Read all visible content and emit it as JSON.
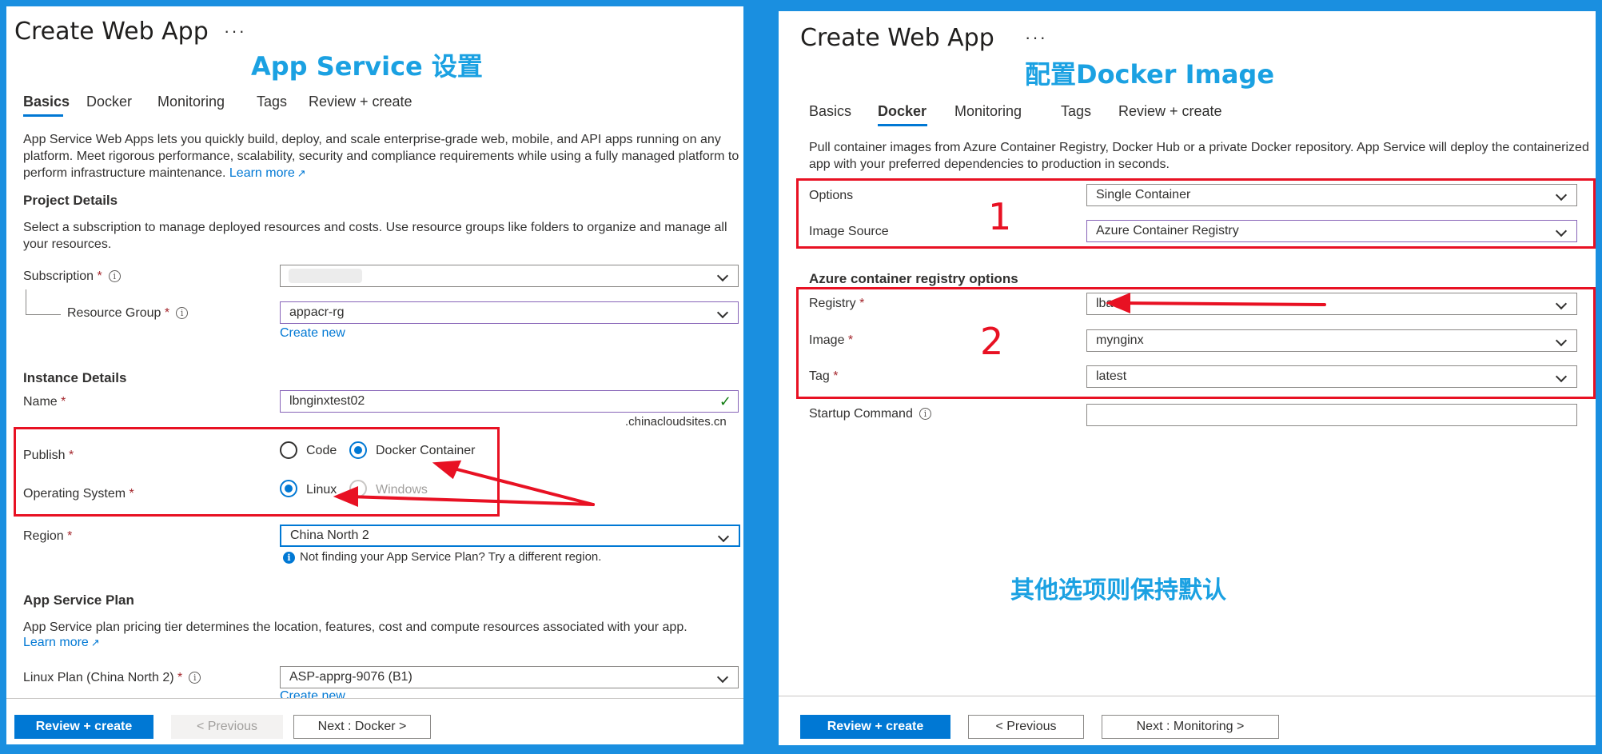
{
  "left": {
    "title": "Create Web App",
    "more": "···",
    "annotation": "App Service 设置",
    "tabs": [
      "Basics",
      "Docker",
      "Monitoring",
      "Tags",
      "Review + create"
    ],
    "description": "App Service Web Apps lets you quickly build, deploy, and scale enterprise-grade web, mobile, and API apps running on any platform. Meet rigorous performance, scalability, security and compliance requirements while using a fully managed platform to perform infrastructure maintenance.",
    "learn_more": "Learn more",
    "project_details": {
      "heading": "Project Details",
      "description": "Select a subscription to manage deployed resources and costs. Use resource groups like folders to organize and manage all your resources.",
      "subscription_label": "Subscription",
      "subscription_value": "",
      "resource_group_label": "Resource Group",
      "resource_group_value": "appacr-rg",
      "create_new": "Create new"
    },
    "instance_details": {
      "heading": "Instance Details",
      "name_label": "Name",
      "name_value": "lbnginxtest02",
      "domain_suffix": ".chinacloudsites.cn",
      "publish_label": "Publish",
      "publish_options": [
        "Code",
        "Docker Container"
      ],
      "os_label": "Operating System",
      "os_options": [
        "Linux",
        "Windows"
      ],
      "region_label": "Region",
      "region_value": "China North 2",
      "region_hint": "Not finding your App Service Plan? Try a different region."
    },
    "plan": {
      "heading": "App Service Plan",
      "description": "App Service plan pricing tier determines the location, features, cost and compute resources associated with your app.",
      "learn_more": "Learn more",
      "linux_plan_label": "Linux Plan (China North 2)",
      "linux_plan_value": "ASP-apprg-9076 (B1)",
      "create_new": "Create new"
    },
    "footer": {
      "review_create": "Review + create",
      "previous": "< Previous",
      "next": "Next : Docker >"
    }
  },
  "right": {
    "title": "Create Web App",
    "more": "···",
    "annotation": "配置Docker Image",
    "tabs": [
      "Basics",
      "Docker",
      "Monitoring",
      "Tags",
      "Review + create"
    ],
    "description": "Pull container images from Azure Container Registry, Docker Hub or a private Docker repository. App Service will deploy the containerized app with your preferred dependencies to production in seconds.",
    "options_label": "Options",
    "options_value": "Single Container",
    "image_source_label": "Image Source",
    "image_source_value": "Azure Container Registry",
    "box1_number": "1",
    "acr_heading": "Azure container registry options",
    "registry_label": "Registry",
    "registry_value": "lba",
    "image_label": "Image",
    "image_value": "mynginx",
    "tag_label": "Tag",
    "tag_value": "latest",
    "box2_number": "2",
    "startup_label": "Startup Command",
    "startup_value": "",
    "note": "其他选项则保持默认",
    "footer": {
      "review_create": "Review + create",
      "previous": "< Previous",
      "next": "Next : Monitoring >"
    }
  },
  "colors": {
    "background": "#1a8fe0",
    "annotation_blue": "#1ba1e2",
    "annotation_red": "#e81123",
    "accent": "#0078d4"
  },
  "icons": {
    "required": "*",
    "info": "info-icon",
    "chevron": "chevron-down-icon",
    "check": "checkmark-icon",
    "external_link": "external-link-icon"
  }
}
